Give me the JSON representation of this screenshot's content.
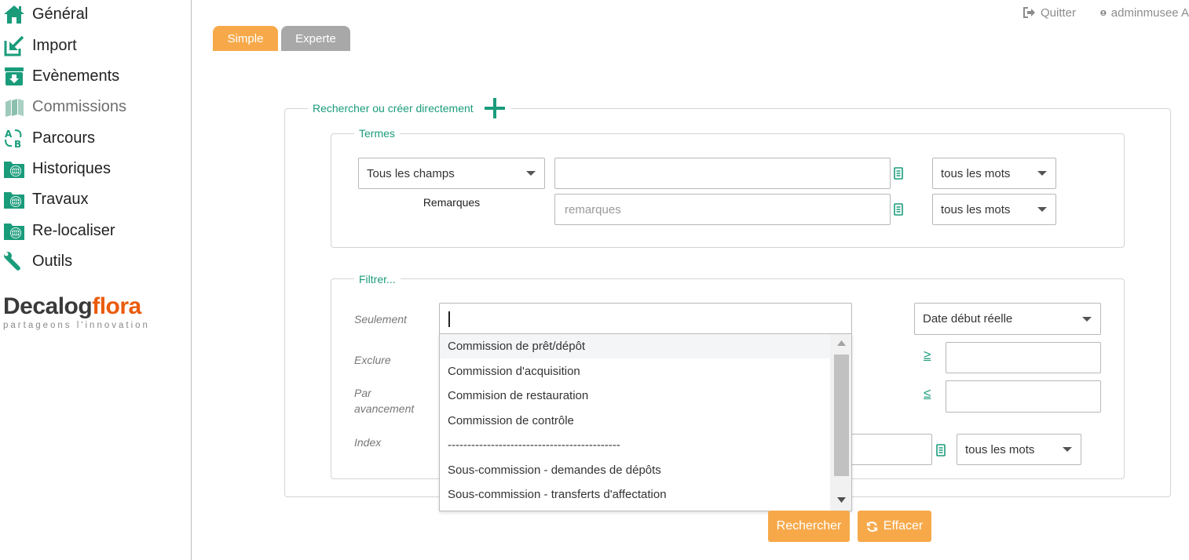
{
  "sidebar": {
    "items": [
      {
        "label": "Général",
        "icon": "home-icon"
      },
      {
        "label": "Import",
        "icon": "import-icon"
      },
      {
        "label": "Evènements",
        "icon": "download-box-icon"
      },
      {
        "label": "Commissions",
        "icon": "books-icon"
      },
      {
        "label": "Parcours",
        "icon": "a-to-b-icon"
      },
      {
        "label": "Historiques",
        "icon": "folder-globe-icon"
      },
      {
        "label": "Travaux",
        "icon": "folder-globe-icon"
      },
      {
        "label": "Re-localiser",
        "icon": "folder-globe-icon"
      },
      {
        "label": "Outils",
        "icon": "wrench-icon"
      }
    ],
    "logo": {
      "part1": "Decalog",
      "part2": "flora",
      "tagline": "partageons l'innovation"
    }
  },
  "header": {
    "quit": "Quitter",
    "user": "adminmusee A"
  },
  "tabs": [
    {
      "label": "Simple",
      "active": true
    },
    {
      "label": "Experte",
      "active": false
    }
  ],
  "search": {
    "legend_prefix": "Rechercher",
    "legend_suffix": "ou créer directement",
    "terms": {
      "legend": "Termes",
      "field_select": "Tous les champs",
      "remarks_label": "Remarques",
      "remarks_placeholder": "remarques",
      "match_mode_1": "tous les mots",
      "match_mode_2": "tous les mots"
    },
    "filter": {
      "legend": "Filtrer...",
      "only_label": "Seulement",
      "exclude_label": "Exclure",
      "progress_label_1": "Par",
      "progress_label_2": "avancement",
      "index_label": "Index",
      "date_select": "Date début réelle",
      "gte": "≥",
      "lte": "≤",
      "index_match_mode": "tous les mots",
      "dropdown_options": [
        "Commission de prêt/dépôt",
        "Commission d'acquisition",
        "Commision de restauration",
        "Commission de contrôle",
        "--------------------------------------------",
        "Sous-commission - demandes de dépôts",
        "Sous-commission - transferts d'affectation"
      ]
    }
  },
  "buttons": {
    "search": "Rechercher",
    "clear": "Effacer"
  },
  "colors": {
    "accent": "#f7a94a",
    "green": "#1a9c7b",
    "tab_inactive": "#a8a8a8",
    "logo_orange": "#ea5b0c"
  }
}
